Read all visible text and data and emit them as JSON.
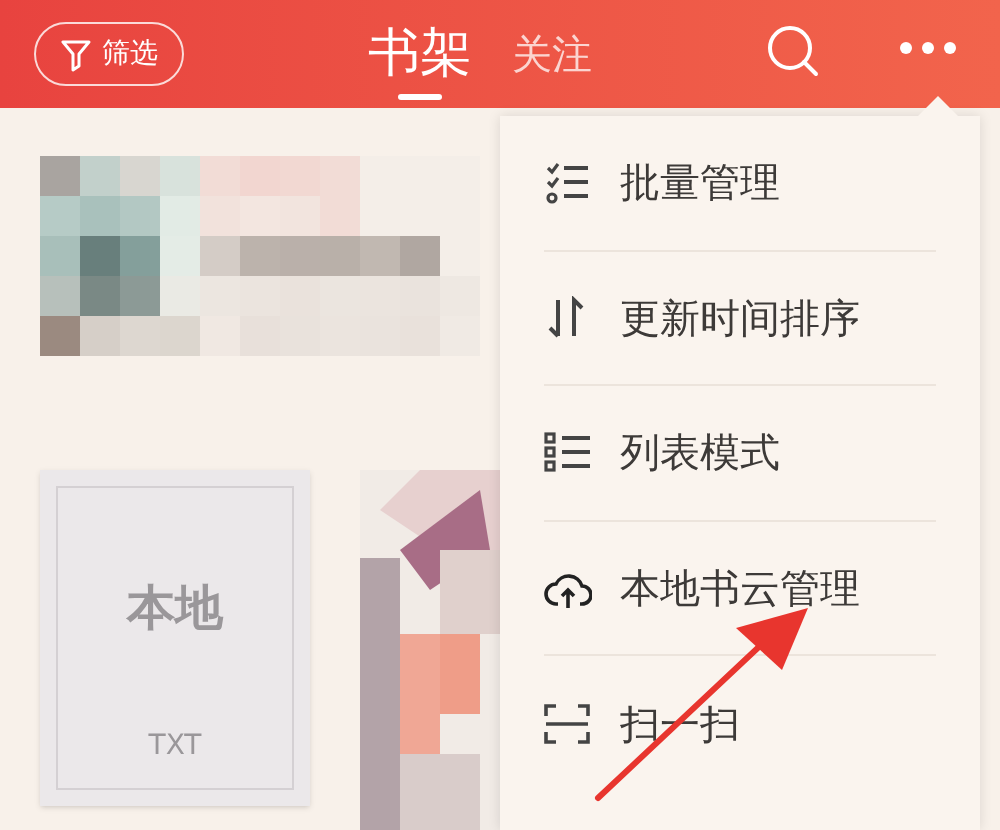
{
  "header": {
    "filter_button": {
      "label": "筛选"
    },
    "tabs": [
      {
        "label": "书架",
        "selected": true
      },
      {
        "label": "关注",
        "selected": false
      }
    ]
  },
  "shelf": {
    "banner": {
      "kind": "picture"
    },
    "books": [
      {
        "kind": "cover",
        "title": "本地",
        "format": "TXT"
      },
      {
        "kind": "picture"
      }
    ]
  },
  "menu": {
    "items": [
      {
        "kind": "checklist",
        "label": "批量管理"
      },
      {
        "kind": "sort",
        "label": "更新时间排序"
      },
      {
        "kind": "list",
        "label": "列表模式"
      },
      {
        "kind": "cloud",
        "label": "本地书云管理"
      },
      {
        "kind": "scan",
        "label": "扫一扫"
      }
    ]
  }
}
